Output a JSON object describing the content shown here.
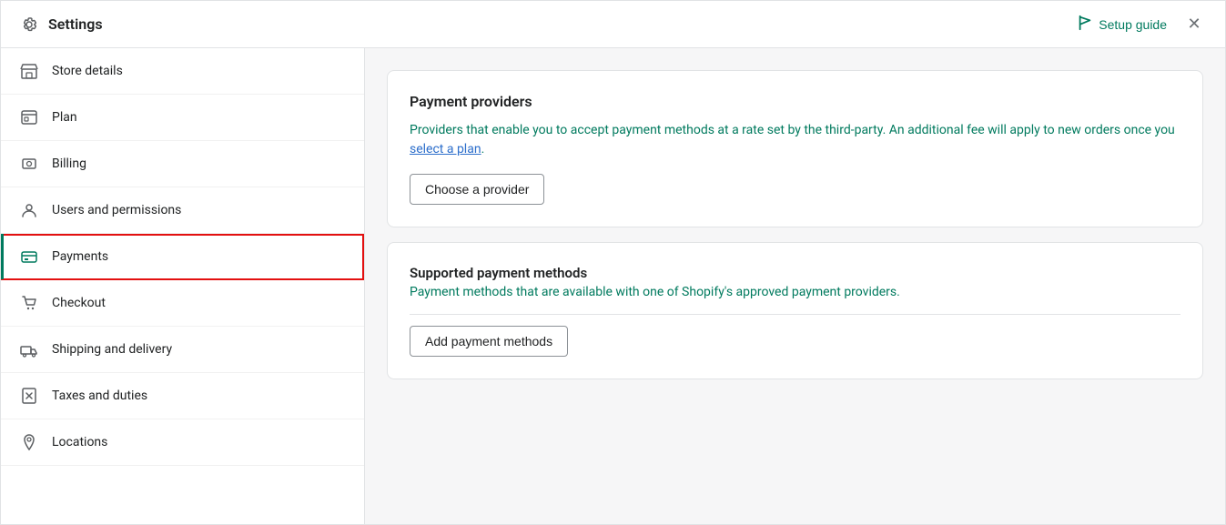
{
  "topBar": {
    "title": "Settings",
    "setupGuide": "Setup guide",
    "closeLabel": "×"
  },
  "sidebar": {
    "items": [
      {
        "id": "store-details",
        "label": "Store details",
        "icon": "store-icon"
      },
      {
        "id": "plan",
        "label": "Plan",
        "icon": "plan-icon"
      },
      {
        "id": "billing",
        "label": "Billing",
        "icon": "billing-icon"
      },
      {
        "id": "users-permissions",
        "label": "Users and permissions",
        "icon": "users-icon"
      },
      {
        "id": "payments",
        "label": "Payments",
        "icon": "payments-icon",
        "active": true
      },
      {
        "id": "checkout",
        "label": "Checkout",
        "icon": "checkout-icon"
      },
      {
        "id": "shipping-delivery",
        "label": "Shipping and delivery",
        "icon": "shipping-icon"
      },
      {
        "id": "taxes-duties",
        "label": "Taxes and duties",
        "icon": "taxes-icon"
      },
      {
        "id": "locations",
        "label": "Locations",
        "icon": "locations-icon"
      }
    ]
  },
  "paymentProviders": {
    "title": "Payment providers",
    "description": "Providers that enable you to accept payment methods at a rate set by the third-party. An additional fee will apply to new orders once you ",
    "linkText": "select a plan",
    "descriptionEnd": ".",
    "chooseProviderBtn": "Choose a provider"
  },
  "supportedPaymentMethods": {
    "title": "Supported payment methods",
    "description": "Payment methods that are available with one of Shopify's approved payment providers.",
    "addMethodBtn": "Add payment methods"
  }
}
